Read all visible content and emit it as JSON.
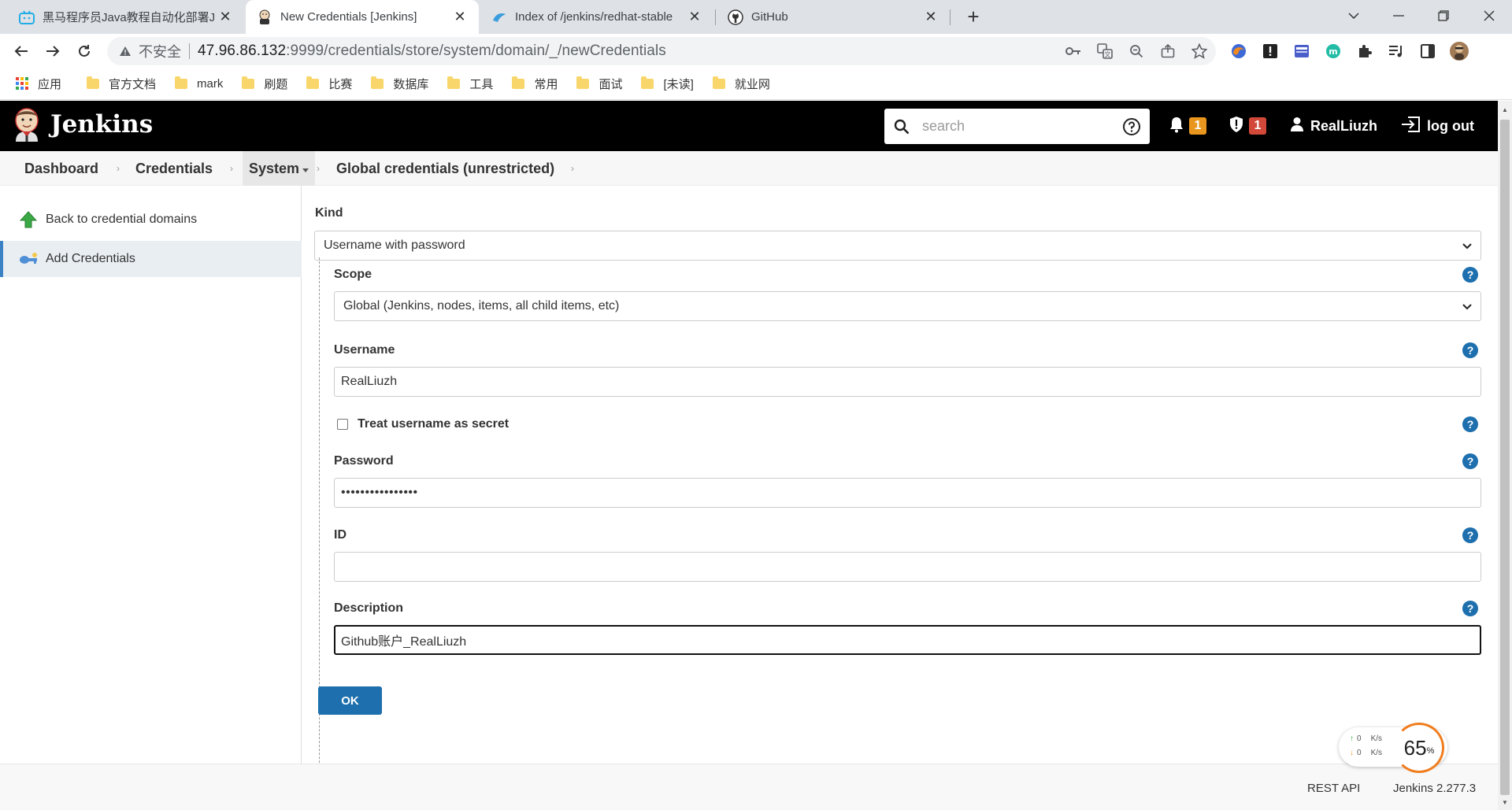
{
  "browser": {
    "tabs": [
      {
        "title": "黑马程序员Java教程自动化部署J",
        "favicon": "bilibili-icon"
      },
      {
        "title": "New Credentials [Jenkins]",
        "favicon": "jenkins-icon"
      },
      {
        "title": "Index of /jenkins/redhat-stable",
        "favicon": "tsinghua-mirror-icon"
      },
      {
        "title": "GitHub",
        "favicon": "github-icon"
      }
    ],
    "address": {
      "insecure_label": "不安全",
      "host": "47.96.86.132",
      "path": ":9999/credentials/store/system/domain/_/newCredentials"
    },
    "bookmarks": [
      {
        "label": "应用",
        "icon": "apps-grid-icon"
      },
      {
        "label": "官方文档",
        "icon": "folder-icon"
      },
      {
        "label": "mark",
        "icon": "folder-icon"
      },
      {
        "label": "刷题",
        "icon": "folder-icon"
      },
      {
        "label": "比赛",
        "icon": "folder-icon"
      },
      {
        "label": "数据库",
        "icon": "folder-icon"
      },
      {
        "label": "工具",
        "icon": "folder-icon"
      },
      {
        "label": "常用",
        "icon": "folder-icon"
      },
      {
        "label": "面试",
        "icon": "folder-icon"
      },
      {
        "label": "[未读]",
        "icon": "folder-icon"
      },
      {
        "label": "就业网",
        "icon": "folder-icon"
      }
    ]
  },
  "header": {
    "title": "Jenkins",
    "search_placeholder": "search",
    "notifications_count": "1",
    "security_count": "1",
    "user": "RealLiuzh",
    "logout": "log out"
  },
  "breadcrumb": {
    "items": [
      "Dashboard",
      "Credentials",
      "System",
      "Global credentials (unrestricted)"
    ]
  },
  "side": {
    "back": "Back to credential domains",
    "add": "Add Credentials"
  },
  "form": {
    "kind_label": "Kind",
    "kind_value": "Username with password",
    "scope_label": "Scope",
    "scope_value": "Global (Jenkins, nodes, items, all child items, etc)",
    "username_label": "Username",
    "username_value": "RealLiuzh",
    "treat_secret_label": "Treat username as secret",
    "password_label": "Password",
    "password_value": "••••••••••••••••",
    "id_label": "ID",
    "id_value": "",
    "description_label": "Description",
    "description_value": "Github账户_RealLiuzh",
    "ok_label": "OK"
  },
  "footer": {
    "rest_api": "REST API",
    "version": "Jenkins 2.277.3"
  },
  "net_widget": {
    "up_speed": "0",
    "down_speed": "0",
    "unit": "K/s",
    "percent": "65",
    "percent_sign": "%"
  },
  "colors": {
    "accent": "#1d6fad",
    "badge_orange": "#e8961d",
    "badge_red": "#d24939",
    "header_bg": "#000000"
  }
}
